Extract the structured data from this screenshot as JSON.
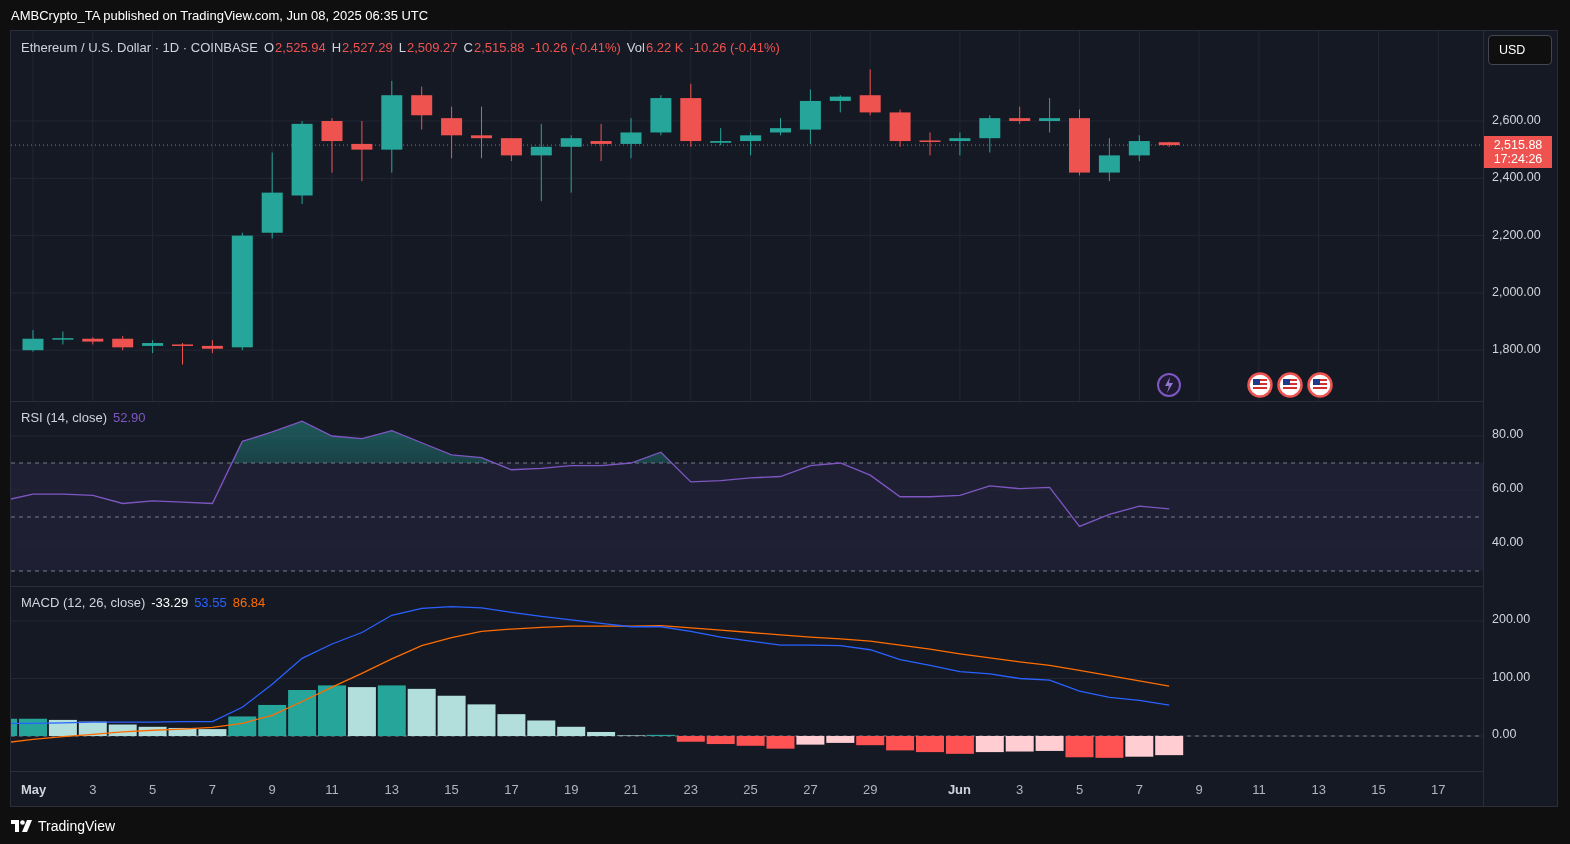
{
  "publish_line": "AMBCrypto_TA published on TradingView.com, Jun 08, 2025 06:35 UTC",
  "legend": {
    "symbol": "Ethereum / U.S. Dollar · 1D · COINBASE",
    "ohlc": [
      {
        "key": "O",
        "value": "2,525.94"
      },
      {
        "key": "H",
        "value": "2,527.29"
      },
      {
        "key": "L",
        "value": "2,509.27"
      },
      {
        "key": "C",
        "value": "2,515.88"
      }
    ],
    "change": "-10.26 (-0.41%)",
    "volume": {
      "key": "Vol",
      "value": "6.22 K",
      "change": "-10.26 (-0.41%)"
    }
  },
  "currency_button": "USD",
  "price_axis": {
    "labels": [
      "2,600.00",
      "2,400.00",
      "2,200.00",
      "2,000.00",
      "1,800.00"
    ],
    "last_price": "2,515.88",
    "countdown": "17:24:26"
  },
  "rsi": {
    "title": "RSI (14, close)",
    "value": "52.90",
    "axis_labels": [
      "80.00",
      "60.00",
      "40.00"
    ]
  },
  "macd": {
    "title": "MACD (12, 26, close)",
    "histogram_value": "-33.29",
    "macd_value": "53.55",
    "signal_value": "86.84",
    "axis_labels": [
      "200.00",
      "100.00",
      "0.00"
    ]
  },
  "time_axis": {
    "labels": [
      "May",
      "3",
      "5",
      "7",
      "9",
      "11",
      "13",
      "15",
      "17",
      "19",
      "21",
      "23",
      "25",
      "27",
      "29",
      "Jun",
      "3",
      "5",
      "7",
      "9",
      "11",
      "13",
      "15",
      "17"
    ]
  },
  "footer": {
    "brand": "TradingView"
  }
}
